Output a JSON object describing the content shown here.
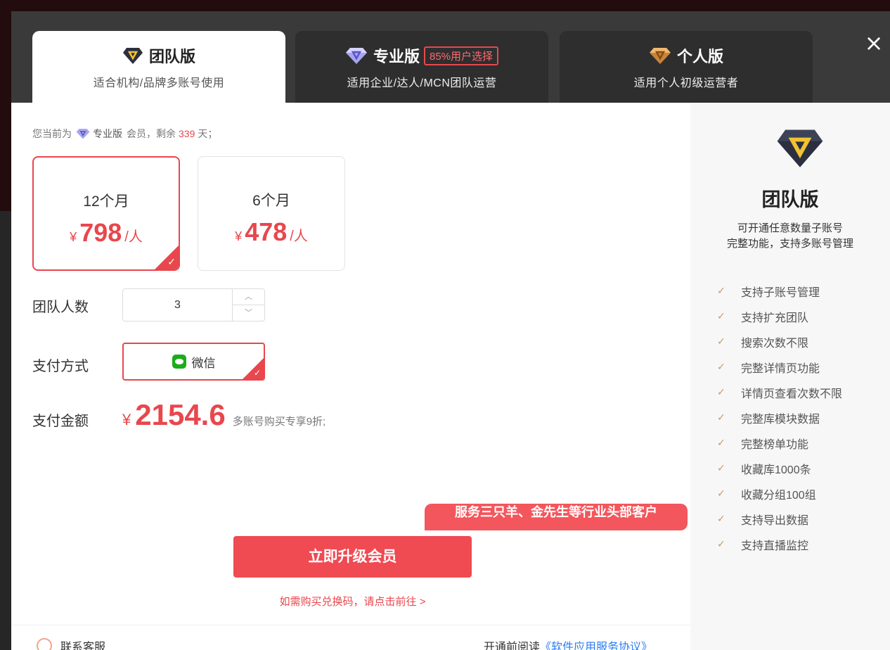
{
  "tabs": [
    {
      "title": "团队版",
      "subtitle": "适合机构/品牌多账号使用",
      "badge": ""
    },
    {
      "title": "专业版",
      "subtitle": "适用企业/达人/MCN团队运营",
      "badge": "85%用户选择"
    },
    {
      "title": "个人版",
      "subtitle": "适用个人初级运营者",
      "badge": ""
    }
  ],
  "close_icon": "×",
  "status": {
    "prefix": "您当前为",
    "vip_name": "专业版",
    "mid": "会员，剩余",
    "days": "339",
    "suffix": "天；"
  },
  "plans": [
    {
      "period": "12个月",
      "currency": "¥",
      "price": "798",
      "unit": "/人",
      "selected": true
    },
    {
      "period": "6个月",
      "currency": "¥",
      "price": "478",
      "unit": "/人",
      "selected": false
    }
  ],
  "check_mark": "✓",
  "team_size": {
    "label": "团队人数",
    "value": "3",
    "up": "︿",
    "down": "﹀"
  },
  "payment": {
    "label": "支付方式",
    "method": "微信"
  },
  "total": {
    "label": "支付金额",
    "currency": "¥",
    "amount": "2154.6",
    "note": "多账号购买专享9折;"
  },
  "promo_banner": "服务三只羊、金先生等行业头部客户",
  "upgrade_button": "立即升级会员",
  "redeem_link": "如需购买兑换码，请点击前往 >",
  "footer": {
    "contact": "联系客服",
    "agreement_prefix": "开通前阅读",
    "agreement_link": "《软件应用服务协议》"
  },
  "side_panel": {
    "title": "团队版",
    "desc_lines": [
      "可开通任意数量子账号",
      "完整功能，支持多账号管理"
    ],
    "features": [
      "支持子账号管理",
      "支持扩充团队",
      "搜索次数不限",
      "完整详情页功能",
      "详情页查看次数不限",
      "完整库模块数据",
      "完整榜单功能",
      "收藏库1000条",
      "收藏分组100组",
      "支持导出数据",
      "支持直播监控"
    ]
  },
  "colors": {
    "accent": "#e8474d",
    "tab_dark": "#2e2e2e",
    "check_gold": "#c9995c",
    "link_blue": "#2d7cf0",
    "wechat_green": "#1aad19"
  }
}
